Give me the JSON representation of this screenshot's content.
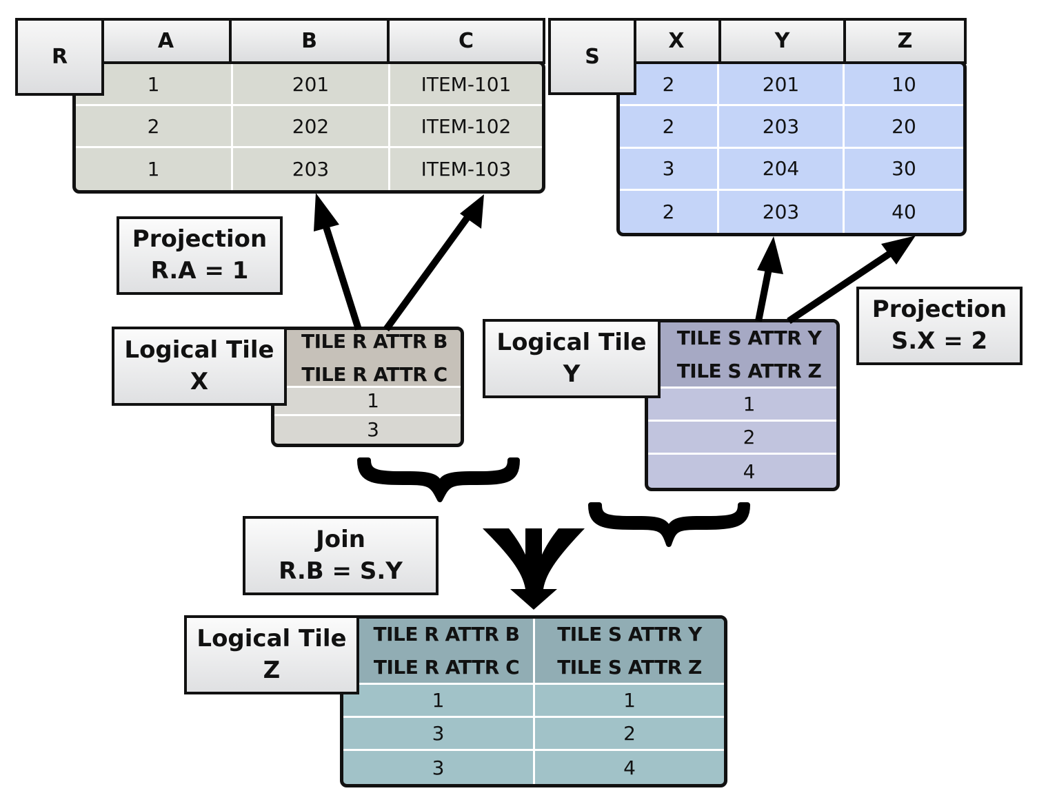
{
  "colors": {
    "table_r": "#d8dad2",
    "table_s": "#c4d4f8",
    "tile_x_head": "#c6c1b9",
    "tile_x_body": "#d8d7d2",
    "tile_y_head": "#a6a9c4",
    "tile_y_body": "#c1c4de",
    "tile_z_head": "#91adb4",
    "tile_z_body": "#a1c2c8"
  },
  "table_r": {
    "name": "R",
    "columns": [
      "A",
      "B",
      "C"
    ],
    "rows": [
      [
        "1",
        "201",
        "ITEM-101"
      ],
      [
        "2",
        "202",
        "ITEM-102"
      ],
      [
        "1",
        "203",
        "ITEM-103"
      ]
    ]
  },
  "table_s": {
    "name": "S",
    "columns": [
      "X",
      "Y",
      "Z"
    ],
    "rows": [
      [
        "2",
        "201",
        "10"
      ],
      [
        "2",
        "203",
        "20"
      ],
      [
        "3",
        "204",
        "30"
      ],
      [
        "2",
        "203",
        "40"
      ]
    ]
  },
  "projection_r": {
    "title": "Projection",
    "predicate": "R.A = 1"
  },
  "projection_s": {
    "title": "Projection",
    "predicate": "S.X = 2"
  },
  "join": {
    "title": "Join",
    "predicate": "R.B = S.Y"
  },
  "tile_x": {
    "label_line1": "Logical Tile",
    "label_line2": "X",
    "header": [
      "TILE R ATTR B",
      "TILE R ATTR C"
    ],
    "rows": [
      "1",
      "3"
    ]
  },
  "tile_y": {
    "label_line1": "Logical Tile",
    "label_line2": "Y",
    "header": [
      "TILE S ATTR Y",
      "TILE S ATTR Z"
    ],
    "rows": [
      "1",
      "2",
      "4"
    ]
  },
  "tile_z": {
    "label_line1": "Logical Tile",
    "label_line2": "Z",
    "columns": [
      {
        "header": [
          "TILE R ATTR B",
          "TILE R ATTR C"
        ]
      },
      {
        "header": [
          "TILE S ATTR Y",
          "TILE S ATTR Z"
        ]
      }
    ],
    "rows": [
      [
        "1",
        "1"
      ],
      [
        "3",
        "2"
      ],
      [
        "3",
        "4"
      ]
    ]
  }
}
